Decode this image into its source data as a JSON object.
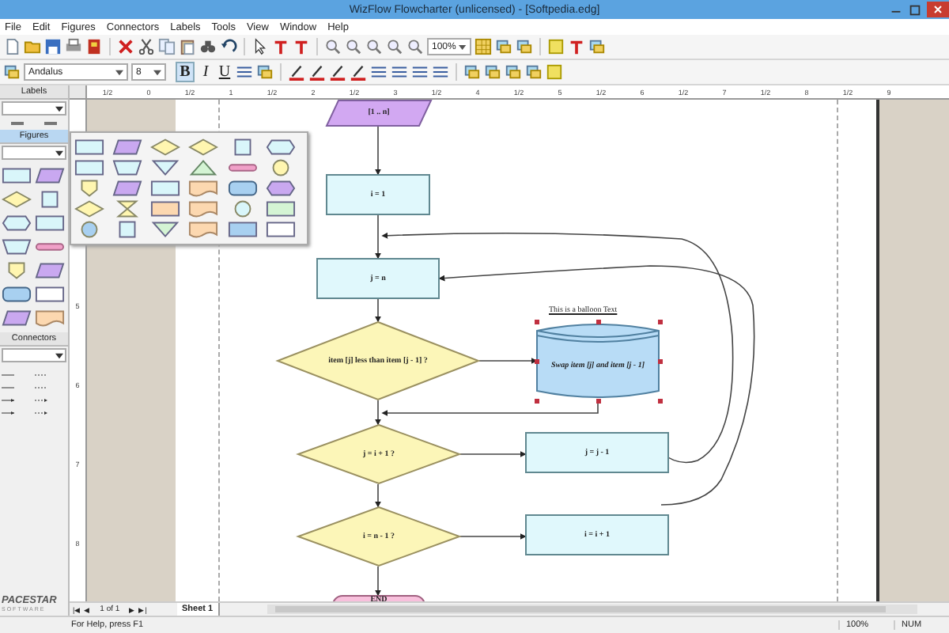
{
  "window": {
    "title": "WizFlow Flowcharter (unlicensed) - [Softpedia.edg]"
  },
  "menu": [
    "File",
    "Edit",
    "Figures",
    "Connectors",
    "Labels",
    "Tools",
    "View",
    "Window",
    "Help"
  ],
  "toolbar": {
    "zoom": "100%",
    "font": "Andalus",
    "font_size": "8",
    "bold": "B",
    "italic": "I",
    "underline": "U"
  },
  "ruler": {
    "horizontal": [
      "1/2",
      "0",
      "1/2",
      "1",
      "1/2",
      "2",
      "1/2",
      "3",
      "1/2",
      "4",
      "1/2",
      "5",
      "1/2",
      "6",
      "1/2",
      "7",
      "1/2",
      "8",
      "1/2",
      "9"
    ],
    "vertical": [
      "5",
      "6",
      "7",
      "8"
    ]
  },
  "left_panel": {
    "sections": [
      {
        "title": "Labels",
        "selected": false
      },
      {
        "title": "Figures",
        "selected": true
      },
      {
        "title": "Connectors",
        "selected": false
      }
    ]
  },
  "logo": {
    "name": "PACESTAR",
    "tagline": "SOFTWARE"
  },
  "flowchart": {
    "balloon": "This is a balloon Text",
    "nodes": [
      {
        "kind": "io",
        "text": "[1 .. n]",
        "selected": false
      },
      {
        "kind": "process",
        "text": "i = 1",
        "selected": false
      },
      {
        "kind": "process",
        "text": "j = n",
        "selected": false
      },
      {
        "kind": "decision",
        "text": "item [j] less than item [j - 1] ?",
        "selected": false
      },
      {
        "kind": "storage",
        "text": "Swap item [j] and item [j - 1]",
        "selected": true
      },
      {
        "kind": "decision",
        "text": "j = i + 1 ?",
        "selected": false
      },
      {
        "kind": "process",
        "text": "j = j - 1",
        "selected": false
      },
      {
        "kind": "decision",
        "text": "i = n - 1 ?",
        "selected": false
      },
      {
        "kind": "process",
        "text": "i = i + 1",
        "selected": false
      },
      {
        "kind": "terminal",
        "text": "END",
        "selected": false
      }
    ]
  },
  "sheets": {
    "nav_first": "|◀",
    "nav_prev": "◀",
    "page_indicator": "1 of 1",
    "nav_next": "▶",
    "nav_last": "▶|",
    "tabs": [
      {
        "label": "Sheet 1",
        "selected": true
      }
    ]
  },
  "status_bar": {
    "help": "For Help, press F1",
    "zoom": "100%",
    "num": "NUM"
  }
}
